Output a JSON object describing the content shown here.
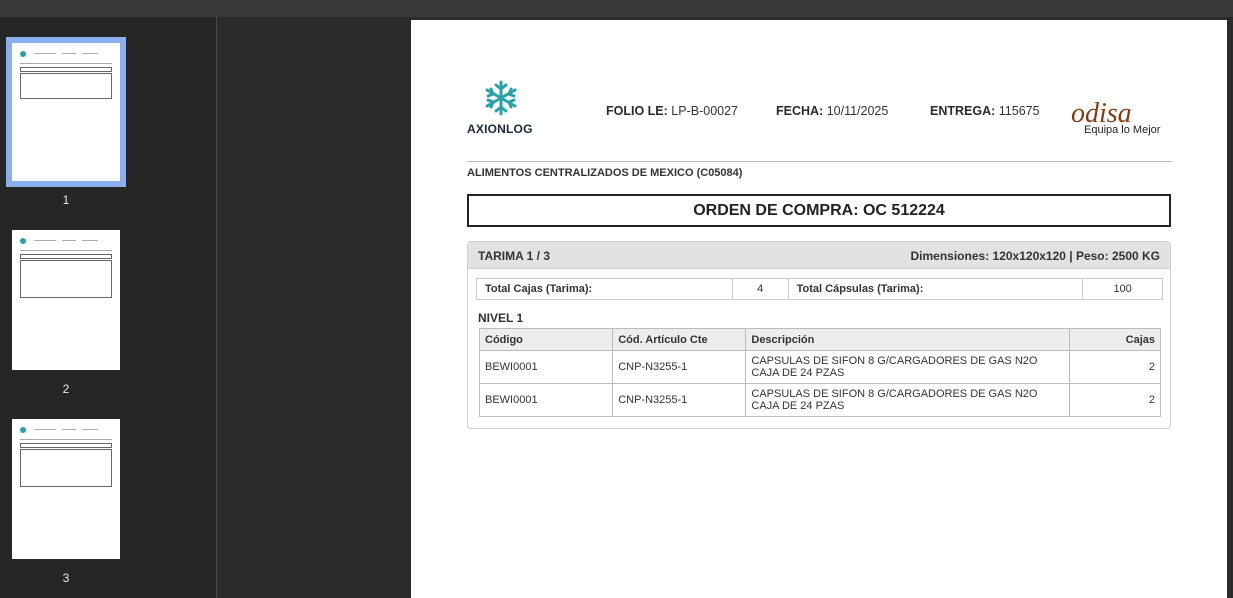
{
  "thumbnails": [
    {
      "label": "1",
      "selected": true
    },
    {
      "label": "2",
      "selected": false
    },
    {
      "label": "3",
      "selected": false
    }
  ],
  "doc": {
    "brand_left": "AXIONLOG",
    "folio_label": "FOLIO LE:",
    "folio_value": "LP-B-00027",
    "fecha_label": "FECHA:",
    "fecha_value": "10/11/2025",
    "entrega_label": "ENTREGA:",
    "entrega_value": "115675",
    "brand_right": "odisa",
    "brand_right_tagline": "Equipa lo Mejor",
    "client": "ALIMENTOS CENTRALIZADOS DE MEXICO (C05084)",
    "orden": "ORDEN DE COMPRA: OC 512224",
    "tarima": {
      "title": "TARIMA 1 / 3",
      "dims": "Dimensiones: 120x120x120 | Peso: 2500 KG",
      "total_cajas_label": "Total Cajas (Tarima):",
      "total_cajas_value": "4",
      "total_capsulas_label": "Total Cápsulas (Tarima):",
      "total_capsulas_value": "100",
      "nivel": "NIVEL 1",
      "columns": [
        "Código",
        "Cód. Artículo Cte",
        "Descripción",
        "Cajas"
      ],
      "rows": [
        {
          "codigo": "BEWI0001",
          "cod_cte": "CNP-N3255-1",
          "descripcion": "CAPSULAS DE SIFON 8 G/CARGADORES DE GAS N2O CAJA DE 24 PZAS",
          "cajas": "2"
        },
        {
          "codigo": "BEWI0001",
          "cod_cte": "CNP-N3255-1",
          "descripcion": "CAPSULAS DE SIFON 8 G/CARGADORES DE GAS N2O CAJA DE 24 PZAS",
          "cajas": "2"
        }
      ]
    }
  },
  "colors": {
    "accent": "#27a3a8",
    "selection": "#8aaef0",
    "brand_right": "#8a3a10"
  }
}
